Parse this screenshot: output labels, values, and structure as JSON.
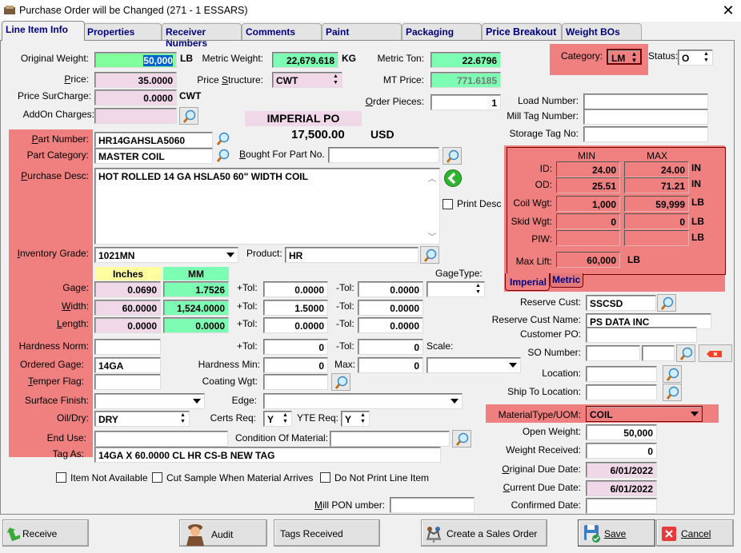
{
  "window": {
    "title": "Purchase Order will be Changed  (271 - 1  ESSARS)"
  },
  "tabs": [
    {
      "label": "Line Item Info",
      "active": true
    },
    {
      "label": "Properties"
    },
    {
      "label": "Receiver Numbers"
    },
    {
      "label": "Comments"
    },
    {
      "label": "Paint"
    },
    {
      "label": "Packaging"
    },
    {
      "label": "Price Breakout"
    },
    {
      "label": "Weight BOs"
    }
  ],
  "weights": {
    "original_weight_label": "Original Weight:",
    "original_weight": "50,000",
    "original_weight_unit": "LB",
    "metric_weight_label": "Metric Weight:",
    "metric_weight": "22,679.618",
    "metric_weight_unit": "KG",
    "metric_ton_label": "Metric Ton:",
    "metric_ton": "22.6796",
    "price_label": "Price:",
    "price": "35.0000",
    "price_structure_label": "Price Structure:",
    "price_structure": "CWT",
    "mt_price_label": "MT Price:",
    "mt_price": "771.6185",
    "price_surcharge_label": "Price SurCharge:",
    "price_surcharge": "0.0000",
    "price_surcharge_unit": "CWT",
    "order_pieces_label": "Order Pieces:",
    "order_pieces": "1",
    "addon_charges_label": "AddOn Charges:",
    "addon_charges": ""
  },
  "po_summary": {
    "po_type": "IMPERIAL PO",
    "total": "17,500.00",
    "currency": "USD"
  },
  "category": {
    "label": "Category:",
    "value": "LM",
    "status_label": "Status:",
    "status_value": "O"
  },
  "tags": {
    "load_number_label": "Load Number:",
    "load_number": "",
    "mill_tag_label": "Mill Tag Number:",
    "mill_tag": "",
    "storage_tag_label": "Storage Tag No:",
    "storage_tag": ""
  },
  "part": {
    "part_number_label": "Part Number:",
    "part_number": "HR14GAHSLA5060",
    "part_category_label": "Part Category:",
    "part_category": "MASTER COIL",
    "bought_for_label": "Bought For Part No.",
    "bought_for": "",
    "purchase_desc_label": "Purchase Desc:",
    "purchase_desc": "HOT ROLLED 14 GA HSLA50 60\" WIDTH COIL",
    "print_desc_label": "Print Desc",
    "inventory_grade_label": "Inventory Grade:",
    "inventory_grade": "1021MN",
    "product_label": "Product:",
    "product": "HR"
  },
  "dimensions": {
    "inches_header": "Inches",
    "mm_header": "MM",
    "gagetype_label": "GageType:",
    "gagetype": "",
    "rows": [
      {
        "label": "Gage:",
        "inches": "0.0690",
        "mm": "1.7526",
        "plus_tol_label": "+Tol:",
        "plus_tol": "0.0000",
        "minus_tol_label": "-Tol:",
        "minus_tol": "0.0000"
      },
      {
        "label": "Width:",
        "inches": "60.0000",
        "mm": "1,524.0000",
        "plus_tol_label": "+Tol:",
        "plus_tol": "1.5000",
        "minus_tol_label": "-Tol:",
        "minus_tol": "0.0000"
      },
      {
        "label": "Length:",
        "inches": "0.0000",
        "mm": "0.0000",
        "plus_tol_label": "+Tol:",
        "plus_tol": "0.0000",
        "minus_tol_label": "-Tol:",
        "minus_tol": "0.0000"
      }
    ],
    "hardness_norm_label": "Hardness Norm:",
    "hardness_norm": "",
    "hardness_plus_tol_label": "+Tol:",
    "hardness_plus_tol": "0",
    "hardness_minus_tol_label": "-Tol:",
    "hardness_minus_tol": "0",
    "scale_label": "Scale:",
    "scale": "",
    "ordered_gage_label": "Ordered Gage:",
    "ordered_gage": "14GA",
    "hardness_min_label": "Hardness Min:",
    "hardness_min": "0",
    "max_label": "Max:",
    "hardness_max": "0",
    "temper_flag_label": "Temper Flag:",
    "temper_flag": "",
    "coating_wgt_label": "Coating Wgt:",
    "coating_wgt": "",
    "surface_finish_label": "Surface Finish:",
    "surface_finish": "",
    "edge_label": "Edge:",
    "edge": "",
    "oil_dry_label": "Oil/Dry:",
    "oil_dry": "DRY",
    "certs_req_label": "Certs Req:",
    "certs_req": "Y",
    "yte_req_label": "YTE Req:",
    "yte_req": "Y",
    "end_use_label": "End Use:",
    "end_use": "",
    "condition_label": "Condition Of Material:",
    "condition": "",
    "tag_as_label": "Tag As:",
    "tag_as": "14GA X 60.0000 CL  HR  CS-B NEW TAG"
  },
  "coil_specs": {
    "min_header": "MIN",
    "max_header": "MAX",
    "rows": [
      {
        "label": "ID:",
        "min": "24.00",
        "max": "24.00",
        "unit": "IN"
      },
      {
        "label": "OD:",
        "min": "25.51",
        "max": "71.21",
        "unit": "IN"
      },
      {
        "label": "Coil Wgt:",
        "min": "1,000",
        "max": "59,999",
        "unit": "LB"
      },
      {
        "label": "Skid Wgt:",
        "min": "0",
        "max": "0",
        "unit": "LB"
      },
      {
        "label": "PIW:",
        "min": "",
        "max": "",
        "unit": "LB"
      }
    ],
    "max_lift_label": "Max Lift:",
    "max_lift": "60,000",
    "max_lift_unit": "LB",
    "tabs": [
      {
        "label": "Imperial",
        "active": true
      },
      {
        "label": "Metric"
      }
    ]
  },
  "reserve": {
    "reserve_cust_label": "Reserve Cust:",
    "reserve_cust": "SSCSD",
    "reserve_cust_name_label": "Reserve Cust Name:",
    "reserve_cust_name": "PS DATA INC",
    "customer_po_label": "Customer PO:",
    "customer_po": "",
    "so_number_label": "SO Number:",
    "so_number": "",
    "so_line": "",
    "location_label": "Location:",
    "location": "",
    "ship_to_label": "Ship To Location:",
    "ship_to": "",
    "material_type_label": "MaterialType/UOM:",
    "material_type": "COIL",
    "open_weight_label": "Open Weight:",
    "open_weight": "50,000",
    "weight_received_label": "Weight Received:",
    "weight_received": "0",
    "original_due_label": "Original Due Date:",
    "original_due": "6/01/2022",
    "current_due_label": "Current Due Date:",
    "current_due": "6/01/2022",
    "confirmed_date_label": "Confirmed Date:",
    "confirmed_date": ""
  },
  "flags": {
    "item_not_available": "Item Not Available",
    "cut_sample": "Cut Sample When Material Arrives",
    "do_not_print": "Do Not Print Line Item",
    "mill_po_label": "Mill PON umber:",
    "mill_po": ""
  },
  "buttons": {
    "receive": "Receive",
    "audit": "Audit",
    "tags_received": "Tags Received",
    "create_so": "Create a Sales Order",
    "save": "Save",
    "cancel": "Cancel"
  },
  "colors": {
    "highlight_red": "#f08080",
    "pink_field": "#f0d8e8",
    "green_field": "#80ff9c",
    "mint_field": "#7dfcb4",
    "tab_text": "#000080"
  }
}
